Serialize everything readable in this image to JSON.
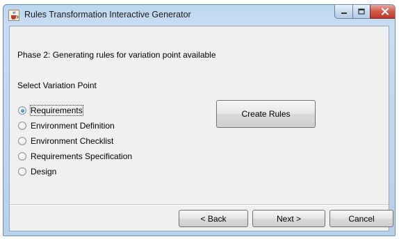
{
  "window": {
    "title": "Rules Transformation Interactive Generator",
    "icon": "java-cup-icon",
    "controls": [
      "minimize-icon",
      "maximize-icon",
      "close-icon"
    ]
  },
  "phase_text": "Phase 2: Generating rules for variation point available",
  "select_label": "Select Variation Point",
  "variation_points": [
    {
      "label": "Requirements",
      "selected": true
    },
    {
      "label": "Environment Definition",
      "selected": false
    },
    {
      "label": "Environment Checklist",
      "selected": false
    },
    {
      "label": "Requirements Specification",
      "selected": false
    },
    {
      "label": "Design",
      "selected": false
    }
  ],
  "buttons": {
    "create_rules": "Create Rules",
    "back": "< Back",
    "next": "Next >",
    "cancel": "Cancel"
  },
  "colors": {
    "title_bar": "#bcd5ef",
    "client_bg": "#f0f0f0",
    "close_button": "#c0392b",
    "radio_selected": "#1f5fa8"
  }
}
